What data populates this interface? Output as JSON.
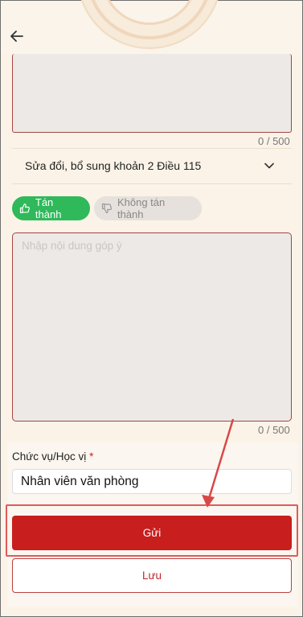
{
  "header": {
    "back_icon": "arrow-left-icon"
  },
  "first_comment": {
    "value": "",
    "counter": "0 / 500"
  },
  "article": {
    "title": "Sửa đổi, bổ sung khoản 2 Điều 115",
    "icon": "chevron-down-icon"
  },
  "vote": {
    "agree_label": "Tán thành",
    "agree_icon": "thumbs-up-icon",
    "agree_color": "#2fb95a",
    "disagree_label": "Không tán thành",
    "disagree_icon": "thumbs-down-icon"
  },
  "comment": {
    "placeholder": "Nhập nội dung góp ý",
    "value": "",
    "counter": "0 / 500"
  },
  "position_field": {
    "label": "Chức vụ/Học vị",
    "required_mark": "*",
    "value": "Nhân viên văn phòng"
  },
  "actions": {
    "send_label": "Gửi",
    "save_label": "Lưu",
    "primary_color": "#c81e1e"
  }
}
